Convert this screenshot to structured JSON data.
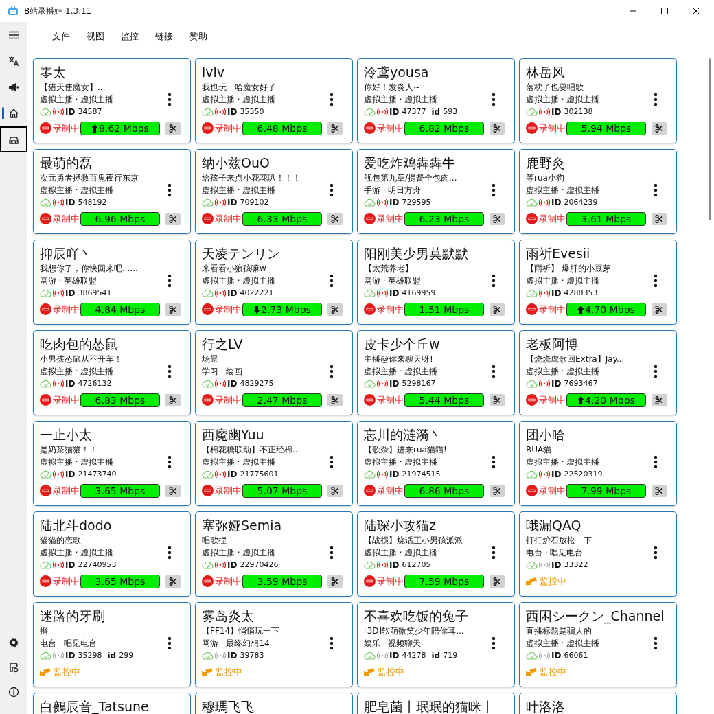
{
  "window": {
    "title": "B站录播姬 1.3.11"
  },
  "sidebar": {
    "items": [
      {
        "kind": "menu",
        "selected": false,
        "focused": false
      },
      {
        "kind": "translate",
        "selected": false,
        "focused": false
      },
      {
        "kind": "megaphone",
        "selected": false,
        "focused": false
      },
      {
        "kind": "home",
        "selected": true,
        "focused": false
      },
      {
        "kind": "car",
        "selected": false,
        "focused": true
      }
    ],
    "bottom_items": [
      {
        "kind": "settings",
        "selected": false,
        "focused": false
      },
      {
        "kind": "badge",
        "selected": false,
        "focused": false
      },
      {
        "kind": "info",
        "selected": false,
        "focused": false
      }
    ]
  },
  "menu": [
    "文件",
    "视图",
    "监控",
    "链接",
    "赞助"
  ],
  "cards": [
    {
      "title": "零太",
      "subtitle": "【猎天使魔女】...",
      "area": "虚拟主播 · 虚拟主播",
      "id_label": "ID",
      "room_id": "34587",
      "live": true,
      "status": {
        "kind": "recording",
        "text": "录制中"
      },
      "bitrate": "8.62 Mbps",
      "rising": true,
      "falling": false
    },
    {
      "title": "lvlv",
      "subtitle": "我也玩一哈魔女好了",
      "area": "虚拟主播 · 虚拟主播",
      "id_label": "ID",
      "room_id": "35350",
      "live": true,
      "status": {
        "kind": "recording",
        "text": "录制中"
      },
      "bitrate": "6.48 Mbps",
      "rising": false,
      "falling": false
    },
    {
      "title": "泠鸢yousa",
      "subtitle": "你好！发炎人~",
      "area": "虚拟主播 · 虚拟主播",
      "id_label": "ID",
      "room_id": "47377",
      "short_id_label": "id",
      "short_id": "593",
      "live": true,
      "status": {
        "kind": "recording",
        "text": "录制中"
      },
      "bitrate": "6.82 Mbps",
      "rising": false,
      "falling": false
    },
    {
      "title": "林岳风",
      "subtitle": "落枕了也要唱歌",
      "area": "虚拟主播 · 虚拟主播",
      "id_label": "ID",
      "room_id": "302138",
      "live": true,
      "status": {
        "kind": "recording",
        "text": "录制中"
      },
      "bitrate": "5.94 Mbps",
      "rising": false,
      "falling": false
    },
    {
      "title": "最萌的磊",
      "subtitle": "次元勇者拯救百鬼夜行东京",
      "area": "虚拟主播 · 虚拟主播",
      "id_label": "ID",
      "room_id": "548192",
      "live": true,
      "status": {
        "kind": "recording",
        "text": "录制中"
      },
      "bitrate": "6.96 Mbps",
      "rising": false,
      "falling": false
    },
    {
      "title": "纳小兹OuO",
      "subtitle": "给孩子来点小花花叭！！！",
      "area": "虚拟主播 · 虚拟主播",
      "id_label": "ID",
      "room_id": "709102",
      "live": true,
      "status": {
        "kind": "recording",
        "text": "录制中"
      },
      "bitrate": "6.33 Mbps",
      "rising": false,
      "falling": false
    },
    {
      "title": "爱吃炸鸡犇犇牛",
      "subtitle": "舰包第九章/提督全包肉...",
      "area": "手游 · 明日方舟",
      "id_label": "ID",
      "room_id": "729595",
      "live": true,
      "status": {
        "kind": "recording",
        "text": "录制中"
      },
      "bitrate": "6.23 Mbps",
      "rising": false,
      "falling": false
    },
    {
      "title": "鹿野灸",
      "subtitle": "等rua小狗",
      "area": "虚拟主播 · 虚拟主播",
      "id_label": "ID",
      "room_id": "2064239",
      "live": true,
      "status": {
        "kind": "recording",
        "text": "录制中"
      },
      "bitrate": "3.61 Mbps",
      "rising": false,
      "falling": false
    },
    {
      "title": "抑辰吖丶",
      "subtitle": "我想你了，你快回来吧......",
      "area": "网游 · 英雄联盟",
      "id_label": "ID",
      "room_id": "3869541",
      "live": true,
      "status": {
        "kind": "recording",
        "text": "录制中"
      },
      "bitrate": "4.84 Mbps",
      "rising": false,
      "falling": false
    },
    {
      "title": "天凌テンリン",
      "subtitle": "来看看小狼孩嘛w",
      "area": "虚拟主播 · 虚拟主播",
      "id_label": "ID",
      "room_id": "4022221",
      "live": true,
      "status": {
        "kind": "recording",
        "text": "录制中"
      },
      "bitrate": "2.73 Mbps",
      "rising": false,
      "falling": true
    },
    {
      "title": "阳刚美少男莫默默",
      "subtitle": "【太荒养老】",
      "area": "网游 · 英雄联盟",
      "id_label": "ID",
      "room_id": "4169959",
      "live": true,
      "status": {
        "kind": "recording",
        "text": "录制中"
      },
      "bitrate": "1.51 Mbps",
      "rising": false,
      "falling": false
    },
    {
      "title": "雨祈Evesii",
      "subtitle": "【雨祈】 爆肝的小豆芽",
      "area": "虚拟主播 · 虚拟主播",
      "id_label": "ID",
      "room_id": "4288353",
      "live": true,
      "status": {
        "kind": "recording",
        "text": "录制中"
      },
      "bitrate": "4.70 Mbps",
      "rising": true,
      "falling": false
    },
    {
      "title": "吃肉包的怂鼠",
      "subtitle": "小男孩怂鼠从不开车！",
      "area": "虚拟主播 · 虚拟主播",
      "id_label": "ID",
      "room_id": "4726132",
      "live": true,
      "status": {
        "kind": "recording",
        "text": "录制中"
      },
      "bitrate": "6.83 Mbps",
      "rising": false,
      "falling": false
    },
    {
      "title": "行之LV",
      "subtitle": "场景",
      "area": "学习 · 绘画",
      "id_label": "ID",
      "room_id": "4829275",
      "live": true,
      "status": {
        "kind": "recording",
        "text": "录制中"
      },
      "bitrate": "2.47 Mbps",
      "rising": false,
      "falling": false
    },
    {
      "title": "皮卡少个丘w",
      "subtitle": "主播@你来聊天呀!",
      "area": "虚拟主播 · 虚拟主播",
      "id_label": "ID",
      "room_id": "5298167",
      "live": true,
      "status": {
        "kind": "recording",
        "text": "录制中"
      },
      "bitrate": "5.44 Mbps",
      "rising": false,
      "falling": false
    },
    {
      "title": "老板阿博",
      "subtitle": "【烧烧虎歌回Extra】Jay...",
      "area": "虚拟主播 · 虚拟主播",
      "id_label": "ID",
      "room_id": "7693467",
      "live": true,
      "status": {
        "kind": "recording",
        "text": "录制中"
      },
      "bitrate": "4.20 Mbps",
      "rising": true,
      "falling": false
    },
    {
      "title": "一止小太",
      "subtitle": "是奶茶猫猫！！",
      "area": "虚拟主播 · 虚拟主播",
      "id_label": "ID",
      "room_id": "21473740",
      "live": true,
      "status": {
        "kind": "recording",
        "text": "录制中"
      },
      "bitrate": "3.65 Mbps",
      "rising": false,
      "falling": false
    },
    {
      "title": "西魔幽Yuu",
      "subtitle": "【棉花糖联动】不正经棉...",
      "area": "虚拟主播 · 虚拟主播",
      "id_label": "ID",
      "room_id": "21775601",
      "live": true,
      "status": {
        "kind": "recording",
        "text": "录制中"
      },
      "bitrate": "5.07 Mbps",
      "rising": false,
      "falling": false
    },
    {
      "title": "忘川的涟漪丶",
      "subtitle": "【歌杂】进来rua猫猫!",
      "area": "虚拟主播 · 虚拟主播",
      "id_label": "ID",
      "room_id": "21974515",
      "live": true,
      "status": {
        "kind": "recording",
        "text": "录制中"
      },
      "bitrate": "6.86 Mbps",
      "rising": false,
      "falling": false
    },
    {
      "title": "团小哈",
      "subtitle": "RUA猫",
      "area": "虚拟主播 · 虚拟主播",
      "id_label": "ID",
      "room_id": "22520319",
      "live": true,
      "status": {
        "kind": "recording",
        "text": "录制中"
      },
      "bitrate": "7.99 Mbps",
      "rising": false,
      "falling": false
    },
    {
      "title": "陆北斗dodo",
      "subtitle": "猫猫的恋歌",
      "area": "虚拟主播 · 虚拟主播",
      "id_label": "ID",
      "room_id": "22740953",
      "live": true,
      "status": {
        "kind": "recording",
        "text": "录制中"
      },
      "bitrate": "3.65 Mbps",
      "rising": false,
      "falling": false
    },
    {
      "title": "塞弥娅Semia",
      "subtitle": "唱歌捏",
      "area": "虚拟主播 · 虚拟主播",
      "id_label": "ID",
      "room_id": "22970426",
      "live": true,
      "status": {
        "kind": "recording",
        "text": "录制中"
      },
      "bitrate": "3.59 Mbps",
      "rising": false,
      "falling": false
    },
    {
      "title": "陆琛小攻猫z",
      "subtitle": "【战损】烧话王小男孩派派",
      "area": "虚拟主播 · 虚拟主播",
      "id_label": "ID",
      "room_id": "612705",
      "live": true,
      "status": {
        "kind": "recording",
        "text": "录制中"
      },
      "bitrate": "7.59 Mbps",
      "rising": false,
      "falling": false
    },
    {
      "title": "哦漏QAQ",
      "subtitle": "打打炉石放松一下",
      "area": "电台 · 唱见电台",
      "id_label": "ID",
      "room_id": "33322",
      "live": false,
      "status": {
        "kind": "monitoring",
        "text": "监控中"
      }
    },
    {
      "title": "迷路的牙刷",
      "subtitle": "播",
      "area": "电台 · 唱见电台",
      "id_label": "ID",
      "room_id": "35298",
      "short_id_label": "id",
      "short_id": "299",
      "live": false,
      "status": {
        "kind": "monitoring",
        "text": "监控中"
      }
    },
    {
      "title": "雾岛炎太",
      "subtitle": "【FF14】悄悄玩一下",
      "area": "网游 · 最终幻想14",
      "id_label": "ID",
      "room_id": "39783",
      "live": false,
      "status": {
        "kind": "monitoring",
        "text": "监控中"
      }
    },
    {
      "title": "不喜欢吃饭的兔子",
      "subtitle": "[3D]软萌微笑少年陪你耳...",
      "area": "娱乐 · 视频聊天",
      "id_label": "ID",
      "room_id": "44278",
      "short_id_label": "id",
      "short_id": "719",
      "live": false,
      "status": {
        "kind": "monitoring",
        "text": "监控中"
      }
    },
    {
      "title": "西困シークン_Channel",
      "subtitle": "直播标题是骗人的",
      "area": "虚拟主播 · 虚拟主播",
      "id_label": "ID",
      "room_id": "66061",
      "live": false,
      "status": {
        "kind": "monitoring",
        "text": "监控中"
      }
    },
    {
      "title": "白鵺辰音_Tatsune"
    },
    {
      "title": "穆瑪飞飞"
    },
    {
      "title": "肥皂菌丨珉珉的猫咪丨"
    },
    {
      "title": "叶洛洛"
    }
  ]
}
